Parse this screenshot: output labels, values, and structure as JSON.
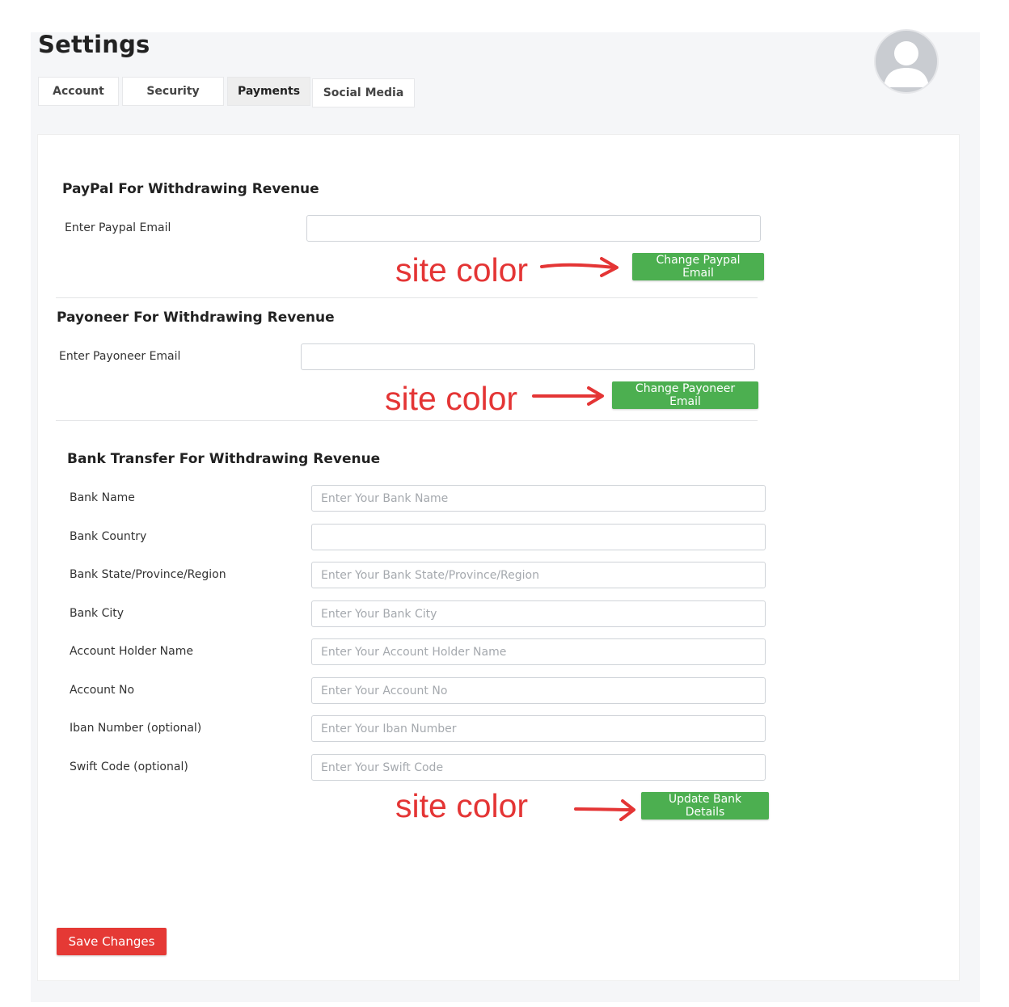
{
  "page": {
    "title": "Settings"
  },
  "tabs": [
    {
      "label": "Account"
    },
    {
      "label": "Security"
    },
    {
      "label": "Payments",
      "active": true
    },
    {
      "label": "Social Media"
    }
  ],
  "paypal": {
    "title": "PayPal For Withdrawing Revenue",
    "email_label": "Enter Paypal Email",
    "email_value": "",
    "button": "Change Paypal Email"
  },
  "payoneer": {
    "title": "Payoneer For Withdrawing Revenue",
    "email_label": "Enter Payoneer Email",
    "email_value": "",
    "button": "Change Payoneer Email"
  },
  "bank": {
    "title": "Bank Transfer For Withdrawing Revenue",
    "fields": [
      {
        "label": "Bank Name",
        "placeholder": "Enter Your Bank Name"
      },
      {
        "label": "Bank Country",
        "placeholder": ""
      },
      {
        "label": "Bank State/Province/Region",
        "placeholder": "Enter Your Bank State/Province/Region"
      },
      {
        "label": "Bank City",
        "placeholder": "Enter Your Bank City"
      },
      {
        "label": "Account Holder Name",
        "placeholder": "Enter Your Account Holder Name"
      },
      {
        "label": "Account No",
        "placeholder": "Enter Your Account No"
      },
      {
        "label": "Iban Number (optional)",
        "placeholder": "Enter Your Iban Number"
      },
      {
        "label": "Swift Code (optional)",
        "placeholder": "Enter Your Swift Code"
      }
    ],
    "button": "Update Bank Details"
  },
  "save_button": "Save Changes",
  "annotations": [
    "site color",
    "site color",
    "site color"
  ],
  "colors": {
    "accent_green": "#4caf50",
    "danger_red": "#e53935",
    "annotation_red": "#e43535"
  },
  "icons": {
    "avatar": "user-avatar-icon",
    "arrow": "arrow-right-icon"
  }
}
